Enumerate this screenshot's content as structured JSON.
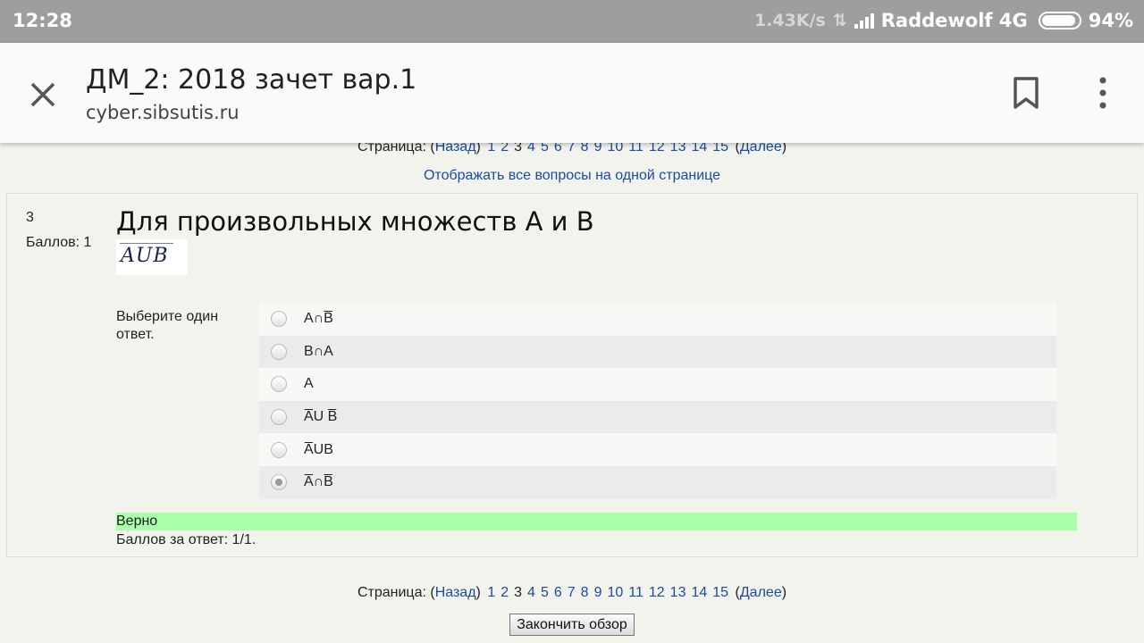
{
  "status_bar": {
    "time": "12:28",
    "speed": "1.43K/s",
    "carrier": "Raddewolf 4G",
    "battery": "94%",
    "battery_level": 0.94
  },
  "toolbar": {
    "title": "ДМ_2: 2018 зачет вар.1",
    "url": "cyber.sibsutis.ru",
    "icons": [
      "close-icon",
      "bookmark-icon",
      "more-vert-icon"
    ]
  },
  "pager": {
    "label": "Страница: (",
    "prev": "Назад",
    "close_paren": ")",
    "pages": [
      "1",
      "2",
      "3",
      "4",
      "5",
      "6",
      "7",
      "8",
      "9",
      "10",
      "11",
      "12",
      "13",
      "14",
      "15"
    ],
    "current": "3",
    "next_open": "(",
    "next": "Далее",
    "next_close": ")"
  },
  "show_all_link": "Отображать все вопросы на одной странице",
  "question": {
    "number": "3",
    "points": "Баллов: 1",
    "text": "Для произвольных множеств A и B",
    "image_text": "AUB",
    "prompt": "Выберите один ответ.",
    "options": [
      {
        "label": "A∩B̅",
        "checked": false
      },
      {
        "label": "B∩A",
        "checked": false
      },
      {
        "label": "A",
        "checked": false
      },
      {
        "label": "A̅U B̅",
        "checked": false
      },
      {
        "label": "A̅UB",
        "checked": false
      },
      {
        "label": "A̅∩B̅",
        "checked": true
      }
    ],
    "feedback": "Верно",
    "score": "Баллов за ответ: 1/1."
  },
  "finish_button": "Закончить обзор"
}
